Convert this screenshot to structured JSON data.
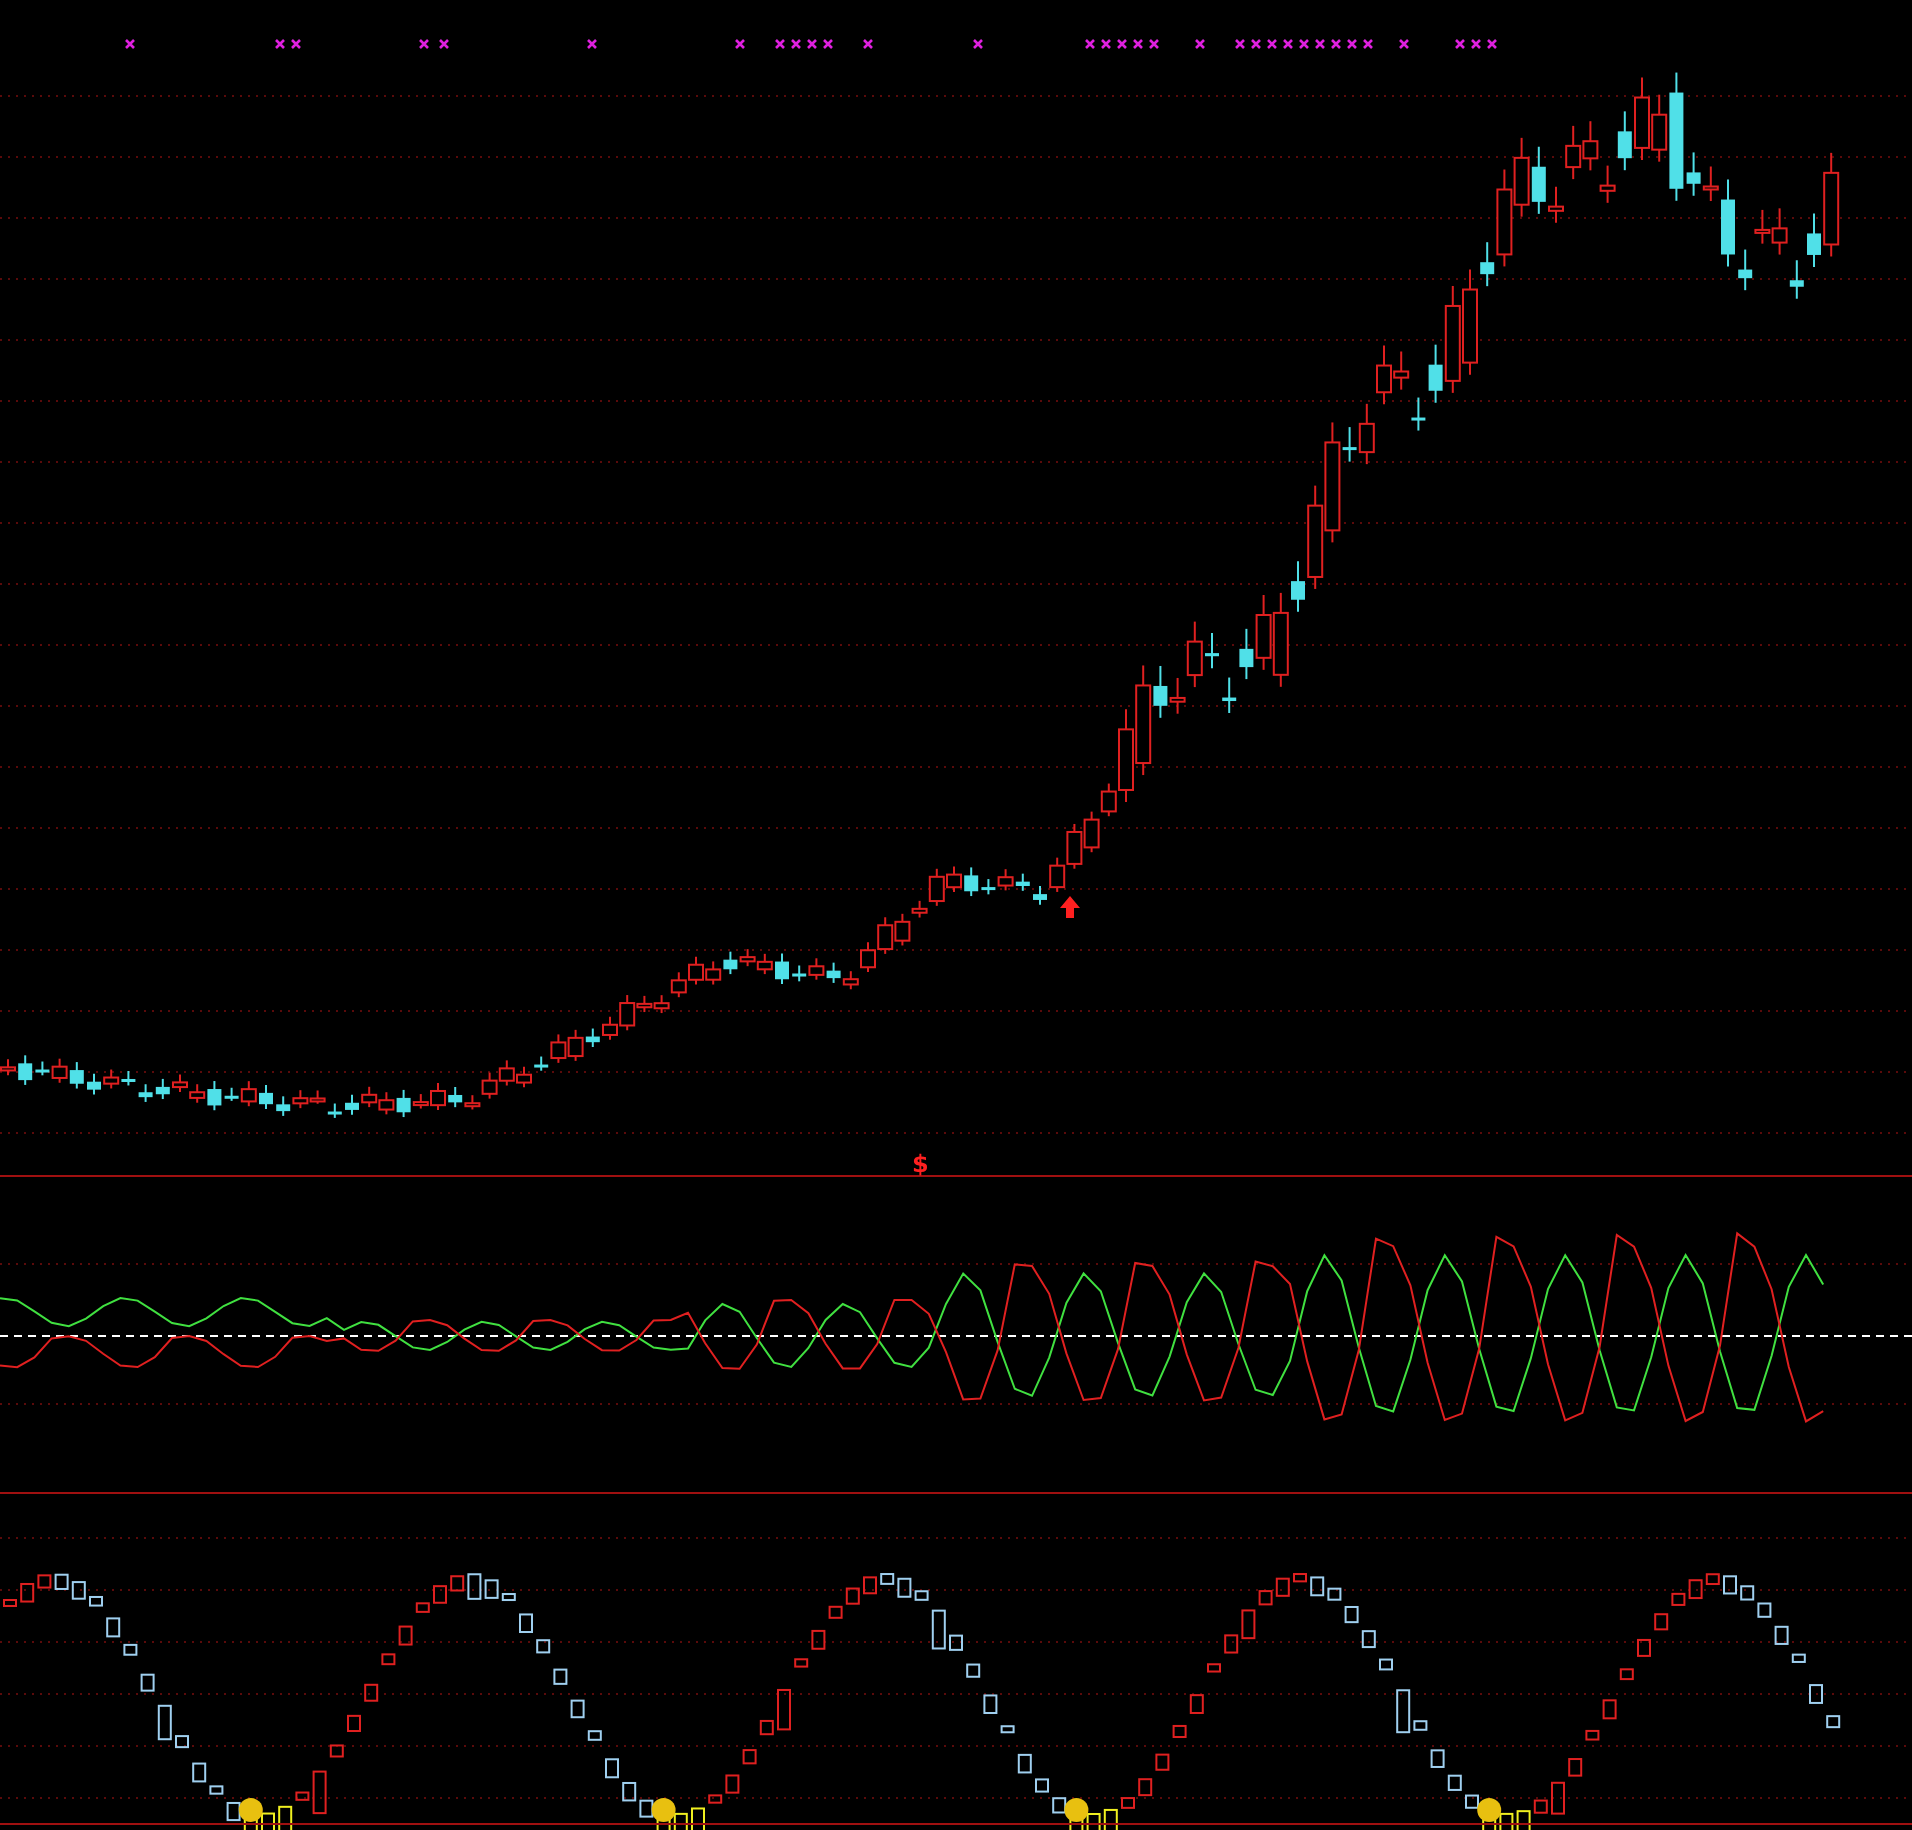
{
  "panels": [
    {
      "kind": "candles"
    },
    {
      "kind": "oscillator",
      "signal": "$"
    },
    {
      "kind": "trend"
    }
  ]
}
